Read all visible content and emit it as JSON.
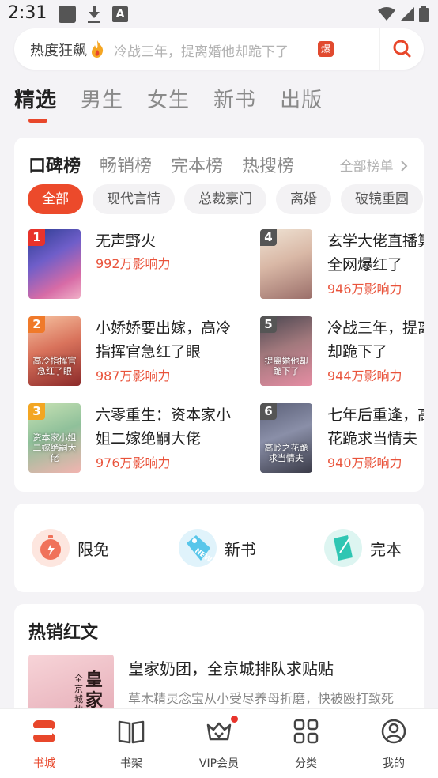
{
  "status": {
    "time": "2:31"
  },
  "search": {
    "hot_label": "热度狂飙",
    "placeholder": "冷战三年，提离婚他却跪下了",
    "badge": "爆"
  },
  "main_tabs": [
    {
      "label": "精选",
      "active": true
    },
    {
      "label": "男生"
    },
    {
      "label": "女生"
    },
    {
      "label": "新书"
    },
    {
      "label": "出版"
    }
  ],
  "ranking": {
    "tabs": [
      {
        "label": "口碑榜",
        "active": true
      },
      {
        "label": "畅销榜"
      },
      {
        "label": "完本榜"
      },
      {
        "label": "热搜榜"
      }
    ],
    "all_label": "全部榜单",
    "filters": [
      {
        "label": "全部",
        "active": true
      },
      {
        "label": "现代言情"
      },
      {
        "label": "总裁豪门"
      },
      {
        "label": "离婚"
      },
      {
        "label": "破镜重圆"
      }
    ],
    "books": [
      {
        "rank": "1",
        "title": "无声野火",
        "heat": "992万影响力",
        "cover_text": "",
        "rank_color": "#e8332b"
      },
      {
        "rank": "2",
        "title": "小娇娇要出嫁，高冷指挥官急红了眼",
        "heat": "987万影响力",
        "cover_text": "高冷指挥官急红了眼",
        "rank_color": "#f07a2a"
      },
      {
        "rank": "3",
        "title": "六零重生：资本家小姐二嫁绝嗣大佬",
        "heat": "976万影响力",
        "cover_text": "资本家小姐二嫁绝嗣大佬",
        "rank_color": "#f3a623"
      },
      {
        "rank": "4",
        "title": "玄学大佬直播算命，全网爆红了",
        "heat": "946万影响力",
        "cover_text": "",
        "rank_color": "#555555"
      },
      {
        "rank": "5",
        "title": "冷战三年，提离婚他却跪下了",
        "heat": "944万影响力",
        "cover_text": "提离婚他却跪下了",
        "rank_color": "#555555"
      },
      {
        "rank": "6",
        "title": "七年后重逢，高岭之花跪求当情夫",
        "heat": "940万影响力",
        "cover_text": "高岭之花跪求当情夫",
        "rank_color": "#555555"
      }
    ]
  },
  "quick": [
    {
      "label": "限免",
      "icon": "stopwatch-icon",
      "color": "#f0725a"
    },
    {
      "label": "新书",
      "icon": "new-tag-icon",
      "color": "#58c6ea"
    },
    {
      "label": "完本",
      "icon": "book-complete-icon",
      "color": "#2fc6b3"
    }
  ],
  "hot": {
    "title": "热销红文",
    "book_title": "皇家奶团，全京城排队求贴贴",
    "book_desc": "草木精灵念宝从小受尽养母折磨，快被殴打致死",
    "cover_text": "皇家",
    "cover_sub": "全京城排"
  },
  "nav": [
    {
      "label": "书城",
      "icon": "bookstore-icon",
      "active": true
    },
    {
      "label": "书架",
      "icon": "bookshelf-icon"
    },
    {
      "label": "VIP会员",
      "icon": "vip-crown-icon"
    },
    {
      "label": "分类",
      "icon": "category-grid-icon"
    },
    {
      "label": "我的",
      "icon": "profile-icon"
    }
  ],
  "colors": {
    "accent": "#e8472b",
    "heat": "#e9533b"
  }
}
